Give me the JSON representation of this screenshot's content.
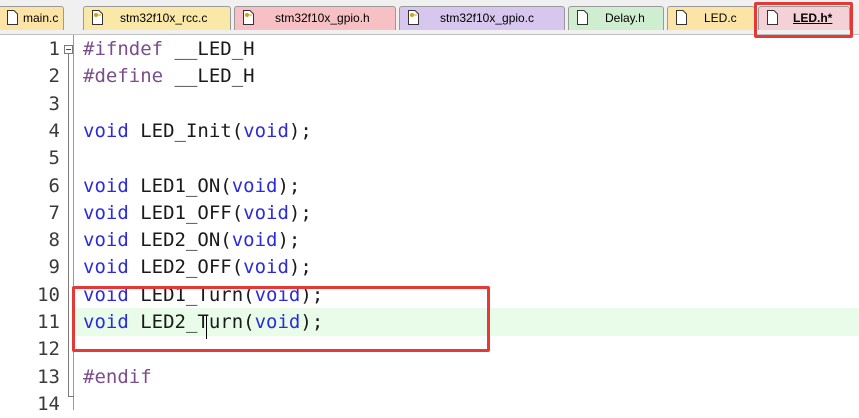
{
  "tabs": [
    {
      "label": "main.c",
      "bg": "#fce4a6",
      "icon": "file-icon"
    },
    {
      "label": "stm32f10x_rcc.c",
      "bg": "#f9e8a8",
      "icon": "key-file-icon"
    },
    {
      "label": "stm32f10x_gpio.h",
      "bg": "#f7c0c4",
      "icon": "key-file-icon"
    },
    {
      "label": "stm32f10x_gpio.c",
      "bg": "#d7c6ee",
      "icon": "key-file-icon"
    },
    {
      "label": "Delay.h",
      "bg": "#cfeed0",
      "icon": "file-icon"
    },
    {
      "label": "LED.c",
      "bg": "#fce4a6",
      "icon": "file-icon"
    },
    {
      "label": "LED.h*",
      "bg": "#f4d1d7",
      "icon": "file-icon",
      "active": true
    }
  ],
  "editor": {
    "lines": [
      {
        "num": "1",
        "text": "#ifndef __LED_H"
      },
      {
        "num": "2",
        "text": "#define __LED_H"
      },
      {
        "num": "3",
        "text": ""
      },
      {
        "num": "4",
        "text": "void LED_Init(void);"
      },
      {
        "num": "5",
        "text": ""
      },
      {
        "num": "6",
        "text": "void LED1_ON(void);"
      },
      {
        "num": "7",
        "text": "void LED1_OFF(void);"
      },
      {
        "num": "8",
        "text": "void LED2_ON(void);"
      },
      {
        "num": "9",
        "text": "void LED2_OFF(void);"
      },
      {
        "num": "10",
        "text": "void LED1_Turn(void);"
      },
      {
        "num": "11",
        "text": "void LED2_Turn(void);",
        "current": true
      },
      {
        "num": "12",
        "text": ""
      },
      {
        "num": "13",
        "text": "#endif"
      },
      {
        "num": "14",
        "text": ""
      }
    ]
  },
  "colors": {
    "keyword": "#2b2bdc",
    "preprocessor": "#7a4d8c",
    "current_line": "#e9fbe9",
    "highlight_box": "#e53935"
  }
}
